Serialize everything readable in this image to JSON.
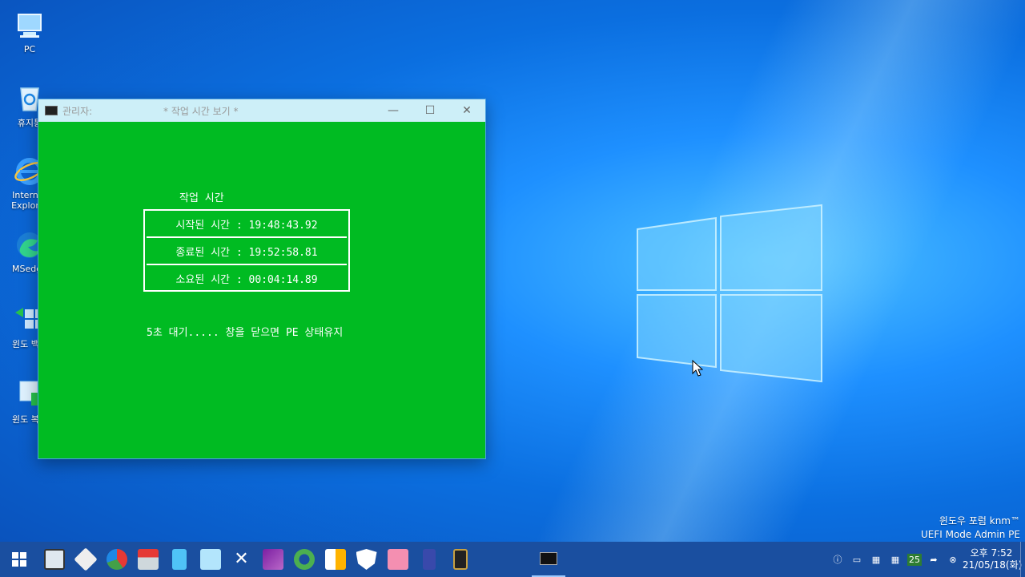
{
  "desktop": {
    "icons": [
      {
        "label": "PC",
        "icon": "computer-icon"
      },
      {
        "label": "휴지통",
        "icon": "recycle-bin-icon"
      },
      {
        "label": "Internet Explorer",
        "icon": "internet-explorer-icon"
      },
      {
        "label": "MSedge",
        "icon": "edge-icon"
      },
      {
        "label": "윈도 백업",
        "icon": "backup-icon"
      },
      {
        "label": "윈도 복원",
        "icon": "restore-icon"
      }
    ],
    "watermark_line1": "윈도우 포럼 knm™",
    "watermark_line2": "UEFI Mode Admin PE"
  },
  "window": {
    "owner": "관리자:",
    "title": "* 작업 시간 보기 *",
    "minimize": "—",
    "maximize": "☐",
    "close": "✕",
    "console": {
      "heading": "작업 시간",
      "rows": [
        "시작된 시간 : 19:48:43.92",
        "종료된 시간 : 19:52:58.81",
        "소요된 시간 : 00:04:14.89"
      ],
      "wait_message": "5초 대기.....  창을 닫으면 PE 상태유지"
    }
  },
  "taskbar": {
    "tray_badge": "25",
    "clock_time": "오후 7:52",
    "clock_date": "21/05/18(화)"
  },
  "colors": {
    "console_bg": "#00bb22",
    "taskbar": "#1a4fa0",
    "titlebar": "#cdeff8"
  }
}
